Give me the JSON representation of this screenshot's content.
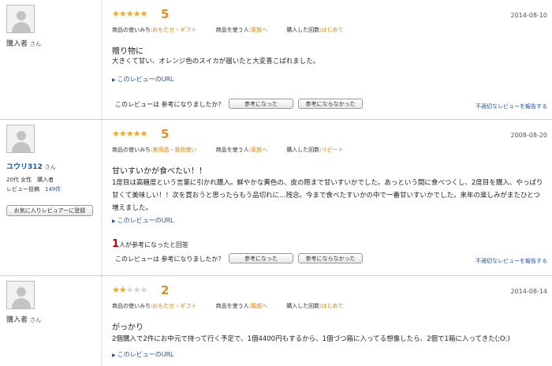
{
  "reviews": [
    {
      "username": "購入者",
      "honorific": "さん",
      "stars_text": "★★★★★",
      "stars_off_text": "",
      "rating": "5",
      "date": "2014-08-10",
      "attr_labels": [
        "商品の使いみち:",
        "商品を使う人:",
        "購入した回数:"
      ],
      "attr_values": [
        "おもたせ・ギフト",
        "家族へ",
        "はじめて"
      ],
      "title": "贈り物に",
      "body": "大きくて甘い、オレンジ色のスイカが届いたと大変喜こばれました。",
      "link_label": "このレビューのURL",
      "question": "このレビューは 参考になりましたか？",
      "yes_label": "参考になった",
      "no_label": "参考にならなかった",
      "report_label": "不適切なレビューを報告する"
    },
    {
      "username": "ユウリ312",
      "honorific": "さん",
      "meta_line1": "20代 女性　購入者",
      "meta_line2_label": "レビュー投稿",
      "meta_line2_count": "149件",
      "fav_label": "お気に入りレビュアーに登録",
      "stars_text": "★★★★★",
      "stars_off_text": "",
      "rating": "5",
      "date": "2008-08-20",
      "attr_labels": [
        "商品の使いみち:",
        "商品を使う人:",
        "購入した回数:"
      ],
      "attr_values": [
        "実用品・普段使い",
        "家族へ",
        "リピート"
      ],
      "title": "甘いすいかが食べたい！！",
      "body": "1度目は高糖度という言葉に引かれ購入。鮮やかな黄色の、皮の際まで甘いすいかでした。あっという間に食べつくし、2度目を購入、やっぱり甘くて美味しい！！次を買おうと思ったらもう品切れに…残念。今まで食べたすいかの中で一番甘いすいかでした。来年の楽しみがまたひとつ増えました。",
      "link_label": "このレビューのURL",
      "helpful_count": "1",
      "helpful_text": "人が参考になったと回答",
      "question": "このレビューは 参考になりましたか？",
      "yes_label": "参考になった",
      "no_label": "参考にならなかった",
      "report_label": "不適切なレビューを報告する"
    },
    {
      "username": "購入者",
      "honorific": "さん",
      "stars_text": "★★",
      "stars_off_text": "★★★",
      "rating": "2",
      "date": "2014-08-14",
      "attr_labels": [
        "商品の使いみち:",
        "商品を使う人:",
        "購入した回数:"
      ],
      "attr_values": [
        "おもたせ・ギフト",
        "親戚へ",
        "はじめて"
      ],
      "title": "がっかり",
      "body": "2個購入で2件にお中元で持って行く予定で、1個4400円もするから、1個づつ箱に入ってる想像したら、2個で1箱に入ってきた(;O;)",
      "link_label": "このレビューのURL"
    }
  ],
  "colors": {
    "star": "#f0a52c",
    "score": "#d9912a",
    "attr_value": "#e08000",
    "link": "#2255aa",
    "helpful_count": "#cc0000"
  }
}
